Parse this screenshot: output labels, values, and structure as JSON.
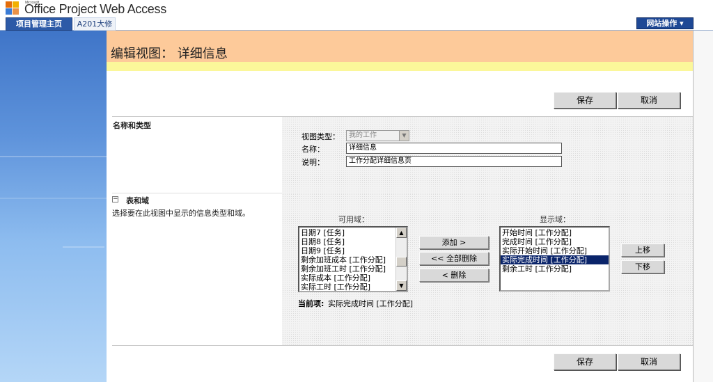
{
  "header": {
    "brand_small": "Microsoft",
    "brand": "Office Project Web Access",
    "logo_colors": [
      "#e36c0a",
      "#f2b000",
      "#3a7bd5",
      "#e36c0a"
    ]
  },
  "tabs": [
    {
      "label": "项目管理主页",
      "active": true
    },
    {
      "label": "A201大修",
      "active": false
    }
  ],
  "site_actions": {
    "label": "网站操作 ▾"
  },
  "page": {
    "title": "编辑视图： 详细信息"
  },
  "toolbar": {
    "save_label": "保存",
    "cancel_label": "取消"
  },
  "section_name_type": {
    "title": "名称和类型",
    "view_type_label": "视图类型：",
    "view_type_value": "我的工作",
    "name_label": "名称：",
    "name_value": "详细信息",
    "description_label": "说明：",
    "description_value": "工作分配详细信息页"
  },
  "section_tables_fields": {
    "title": "表和域",
    "description": "选择要在此视图中显示的信息类型和域。",
    "available_label": "可用域：",
    "displayed_label": "显示域：",
    "available_items": [
      "日期7 [任务]",
      "日期8 [任务]",
      "日期9 [任务]",
      "剩余加班成本 [工作分配]",
      "剩余加班工时 [工作分配]",
      "实际成本 [工作分配]",
      "实际工时 [工作分配]"
    ],
    "displayed_items": [
      "开始时间 [工作分配]",
      "完成时间 [工作分配]",
      "实际开始时间 [工作分配]",
      "实际完成时间 [工作分配]",
      "剩余工时 [工作分配]"
    ],
    "selected_displayed_index": 3,
    "add_label": "添加 >",
    "remove_all_label": "<< 全部删除",
    "remove_label": "< 删除",
    "move_up_label": "上移",
    "move_down_label": "下移",
    "current_label": "当前项:",
    "current_value": "实际完成时间 [工作分配]"
  },
  "colors": {
    "title_band": "#fdca9a",
    "yellow_band": "#fbf79a",
    "tab_active": "#2d5aa7",
    "selection": "#0a246a"
  }
}
